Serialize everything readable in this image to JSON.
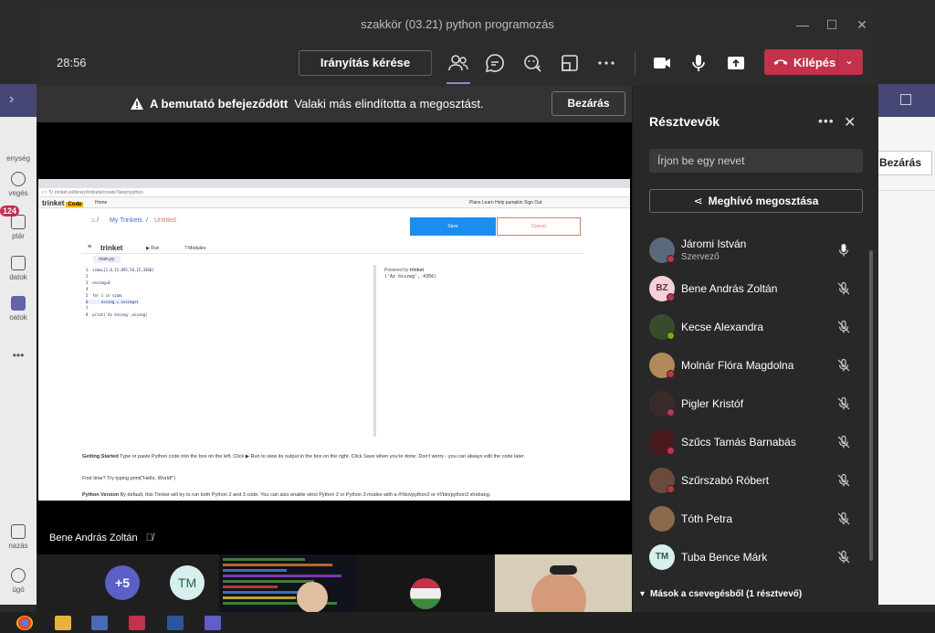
{
  "window": {
    "title": "szakkör (03.21) python programozás"
  },
  "toolbar": {
    "timer": "28:56",
    "control_request": "Irányítás kérése",
    "leave": "Kilépés",
    "icons": [
      "people-icon",
      "chat-icon",
      "reactions-icon",
      "breakout-icon",
      "more-icon",
      "camera-icon",
      "mic-icon",
      "share-icon"
    ]
  },
  "banner": {
    "title": "A bemutató befejeződött",
    "message": "Valaki más elindította a megosztást.",
    "close": "Bezárás"
  },
  "background": {
    "badge": "124",
    "close": "Bezárás",
    "nav_fragments": [
      "enység",
      "vegés",
      "ptár",
      "datok",
      "oatok",
      "nazás",
      "ügó"
    ]
  },
  "shared_screen": {
    "url": "trinket.io/library/trinkets/create?lang=python",
    "logo": "trinket",
    "logo_tag": "Code",
    "home": "Home",
    "nav_right": "Plans   Learn   Help   pumpkin   Sign Out",
    "breadcrumb_home": "My Trinkets",
    "breadcrumb_current": "Untitled",
    "save": "Save",
    "cancel": "Cancel",
    "run": "Run",
    "modules": "Modules",
    "file": "main.py",
    "code": [
      "1  szam=[1,6,15,895,56,15,3366]",
      "2  ",
      "3  osszeg=0",
      "4  ",
      "5  for i in szam:",
      "6      osszeg = osszeg+i",
      "7  ",
      "8  print('Az összeg',osszeg)"
    ],
    "output_powered": "Powered by",
    "output": "('Az összeg', 4356)",
    "getting_started_label": "Getting Started",
    "getting_started": "Type or paste Python code into the box on the left. Click ▶ Run to view its output in the box on the right. Click Save when you're done. Don't worry - you can always edit the code later.",
    "first_time": "First time? Try typing print(\"Hello, World!\")",
    "python_version_label": "Python Version",
    "python_version": "By default, this Trinket will try to run both Python 2 and 3 code. You can also enable strict Python 2 or Python 3 modes with a #!/bin/python2 or #!/bin/python3 shebang."
  },
  "presenter": {
    "name": "Bene András Zoltán"
  },
  "strip": {
    "more_count": "+5",
    "tm_initials": "TM"
  },
  "participants": {
    "title": "Résztvevők",
    "search_placeholder": "Írjon be egy nevet",
    "invite": "Meghívó megosztása",
    "people": [
      {
        "name": "Járomi István",
        "role": "Szervező",
        "initials": "",
        "mic": "on",
        "status": "red",
        "avatar": "#5a6a7a"
      },
      {
        "name": "Bene András Zoltán",
        "role": "",
        "initials": "BZ",
        "mic": "off",
        "status": "red",
        "avatar": "#f3d1d6"
      },
      {
        "name": "Kecse Alexandra",
        "role": "",
        "initials": "",
        "mic": "off",
        "status": "green",
        "avatar": "#3a4a2e"
      },
      {
        "name": "Molnár Flóra Magdolna",
        "role": "",
        "initials": "",
        "mic": "off",
        "status": "red",
        "avatar": "#b28a5a"
      },
      {
        "name": "Pigler Kristóf",
        "role": "",
        "initials": "",
        "mic": "off",
        "status": "red",
        "avatar": "#3b2a2a"
      },
      {
        "name": "Szűcs Tamás Barnabás",
        "role": "",
        "initials": "",
        "mic": "off",
        "status": "red",
        "avatar": "#4a1a1a"
      },
      {
        "name": "Szűrszabó Róbert",
        "role": "",
        "initials": "",
        "mic": "off",
        "status": "red",
        "avatar": "#6a4a3a"
      },
      {
        "name": "Tóth Petra",
        "role": "",
        "initials": "",
        "mic": "off",
        "status": "",
        "avatar": "#8a6a4a"
      },
      {
        "name": "Tuba Bence Márk",
        "role": "",
        "initials": "TM",
        "mic": "off",
        "status": "",
        "avatar": "#d7f0ee"
      }
    ],
    "others_section": "Mások a csevegésből (1 résztvevő)"
  },
  "colors": {
    "accent": "#8b8cc7",
    "leave": "#c4314b",
    "teams_purple": "#464775",
    "panel": "#292828"
  }
}
